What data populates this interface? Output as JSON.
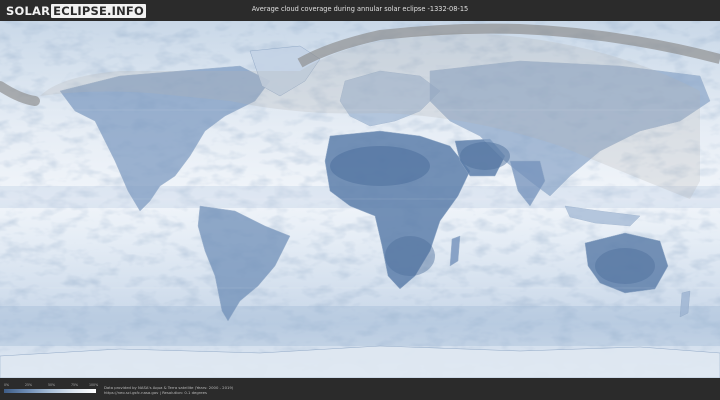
{
  "header": {
    "logo_solar": "SOLAR",
    "logo_eclipse": "ECLIPSE.INFO",
    "title": "Average cloud coverage during annular solar eclipse -1332-08-15"
  },
  "map": {
    "type": "cloud-coverage-world-map",
    "colors": {
      "clear": "#ffffff",
      "cloudy": "#4a6994",
      "eclipse_path": "#8a8a8a",
      "visibility_shade": "#b4b4b4"
    }
  },
  "footer": {
    "scale_labels": [
      "0%",
      "25%",
      "50%",
      "75%",
      "100%"
    ],
    "credit_line1": "Data provided by NASA's Aqua & Terra satellite (Years: 2000 - 2019)",
    "credit_line2": "https://neo.sci.gsfc.nasa.gov  |  Resolution: 0.1 degrees"
  }
}
